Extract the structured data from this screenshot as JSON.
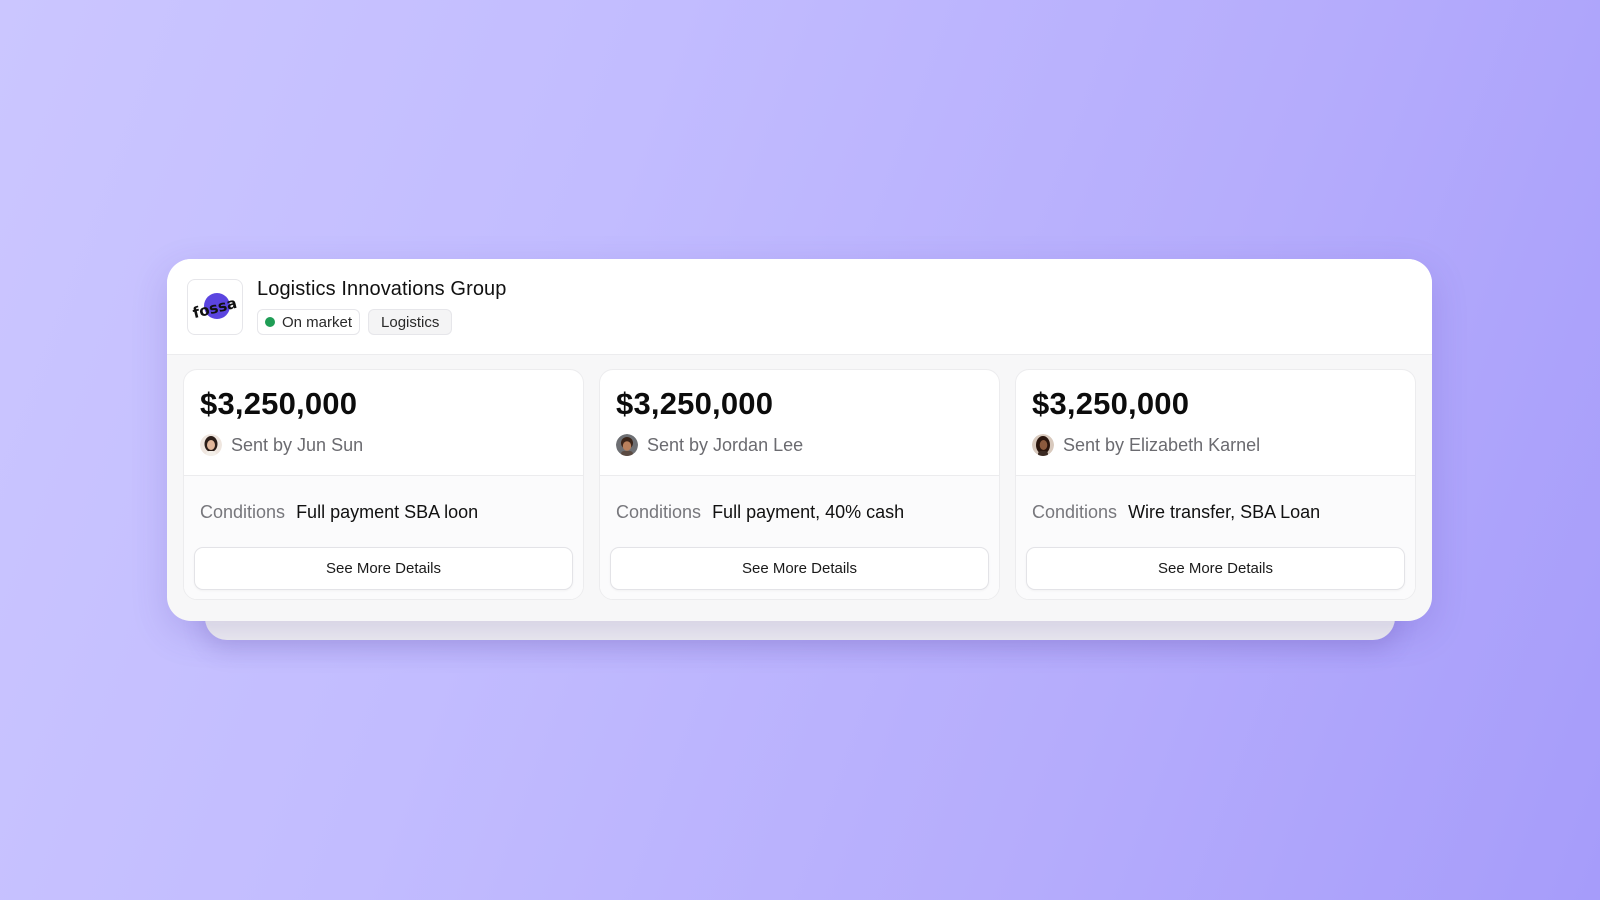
{
  "listing": {
    "logo_text": "fossa",
    "company_name": "Logistics Innovations Group",
    "status_label": "On market",
    "status_color": "#1f9d55",
    "category_tag": "Logistics"
  },
  "offers": [
    {
      "amount": "$3,250,000",
      "sender": "Sent by Jun Sun",
      "conditions_label": "Conditions",
      "conditions_value": "Full payment SBA loon",
      "button_label": "See More Details"
    },
    {
      "amount": "$3,250,000",
      "sender": "Sent by Jordan Lee",
      "conditions_label": "Conditions",
      "conditions_value": "Full payment, 40% cash",
      "button_label": "See More Details"
    },
    {
      "amount": "$3,250,000",
      "sender": "Sent by Elizabeth Karnel",
      "conditions_label": "Conditions",
      "conditions_value": "Wire transfer, SBA Loan",
      "button_label": "See More Details"
    }
  ],
  "colors": {
    "accent_logo": "#5b45e0",
    "background_gradient_start": "#cbc6ff",
    "background_gradient_end": "#a69cfa"
  }
}
